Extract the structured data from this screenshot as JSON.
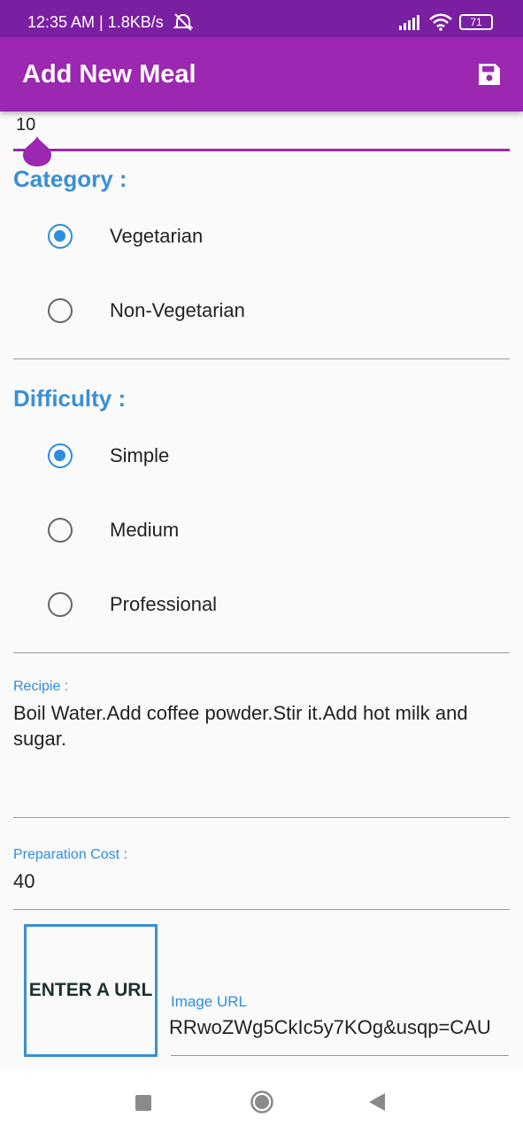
{
  "status_bar": {
    "time_speed": "12:35 AM | 1.8KB/s",
    "icons": [
      "mute-alarm-icon",
      "signal-icon",
      "wifi-icon",
      "battery-icon"
    ],
    "battery_level": "71"
  },
  "app_bar": {
    "title": "Add New Meal",
    "save_icon": "save-icon"
  },
  "duration": {
    "value": "10",
    "slider_fraction": 0.0
  },
  "category": {
    "title": "Category :",
    "options": [
      {
        "label": "Vegetarian",
        "checked": true
      },
      {
        "label": "Non-Vegetarian",
        "checked": false
      }
    ]
  },
  "difficulty": {
    "title": "Difficulty :",
    "options": [
      {
        "label": "Simple",
        "checked": true
      },
      {
        "label": "Medium",
        "checked": false
      },
      {
        "label": "Professional",
        "checked": false
      }
    ]
  },
  "recipe": {
    "label": "Recipie :",
    "value": "Boil Water.Add coffee powder.Stir it.Add hot milk and sugar."
  },
  "cost": {
    "label": "Preparation Cost :",
    "value": "40"
  },
  "image": {
    "button_label": "ENTER A URL",
    "label": "Image URL",
    "value": "RRwoZWg5CkIc5y7KOg&usqp=CAU"
  },
  "colors": {
    "primary": "#9c27b0",
    "primary_dark": "#7b1fa2",
    "accent": "#2f8de0"
  }
}
